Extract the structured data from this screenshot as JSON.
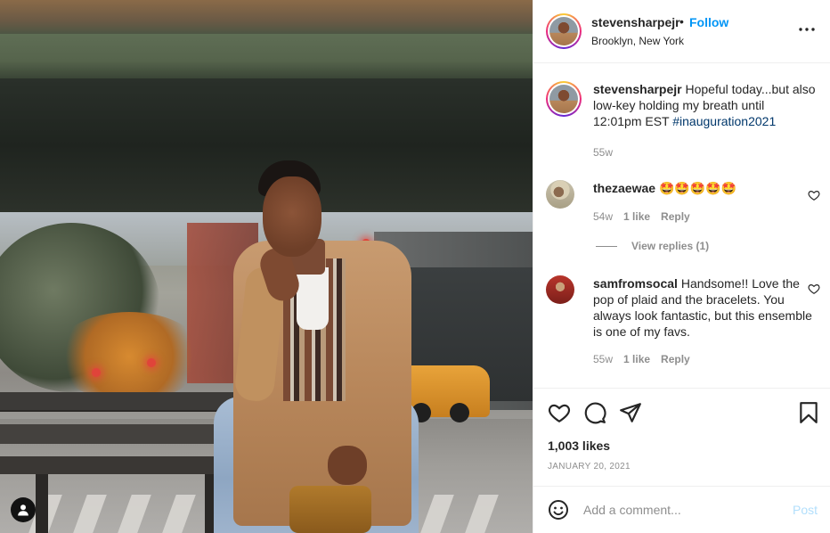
{
  "post": {
    "username": "stevensharpejr",
    "separator": "•",
    "follow_label": "Follow",
    "location": "Brooklyn, New York",
    "more_icon": "more-horizontal-icon"
  },
  "caption": {
    "username": "stevensharpejr",
    "text": "Hopeful today...but also low-key holding my breath until 12:01pm EST",
    "hashtag": "#inauguration2021",
    "time": "55w"
  },
  "comments": [
    {
      "username": "thezaewae",
      "text": "🤩🤩🤩🤩🤩",
      "time": "54w",
      "likes": "1 like",
      "reply": "Reply",
      "view_replies": "View replies (1)"
    },
    {
      "username": "samfromsocal",
      "text": "Handsome!! Love the pop of plaid and the bracelets. You always look fantastic, but this ensemble is one of my favs.",
      "time": "55w",
      "likes": "1 like",
      "reply": "Reply"
    }
  ],
  "actions": {
    "like_icon": "heart-icon",
    "comment_icon": "comment-icon",
    "share_icon": "share-icon",
    "save_icon": "bookmark-icon"
  },
  "likes": "1,003 likes",
  "date": "JANUARY 20, 2021",
  "add_comment": {
    "placeholder": "Add a comment...",
    "post_label": "Post"
  },
  "colors": {
    "accent": "#0095f6",
    "hashtag": "#00376b",
    "muted": "#8e8e8e",
    "post_disabled": "#b2dffc"
  }
}
